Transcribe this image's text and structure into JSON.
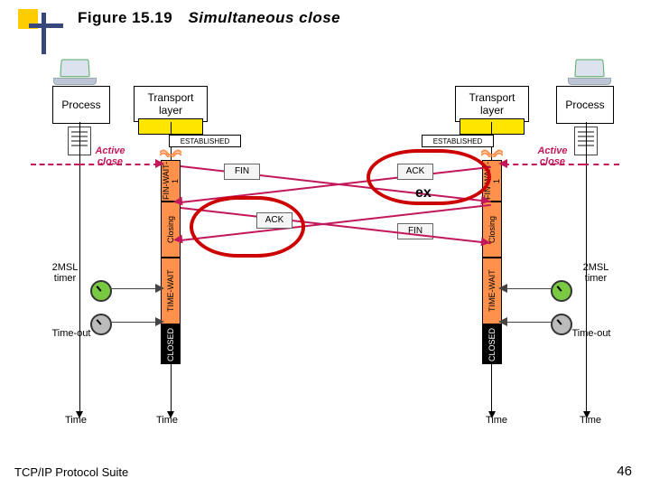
{
  "figure": {
    "number": "Figure 15.19",
    "title": "Simultaneous close"
  },
  "footer": "TCP/IP Protocol Suite",
  "page": "46",
  "boxes": {
    "process": "Process",
    "transport": "Transport layer",
    "established": "ESTABLISHED",
    "fin_wait_1": "FIN-WAIT-1",
    "closing": "Closing",
    "time_wait": "TIME-WAIT",
    "closed": "CLOSED"
  },
  "labels": {
    "active_close": "Active close",
    "msl_timer": "2MSL timer",
    "time_out": "Time-out",
    "time": "Time"
  },
  "messages": {
    "fin": "FIN",
    "ack": "ACK"
  },
  "annotation": "ex"
}
